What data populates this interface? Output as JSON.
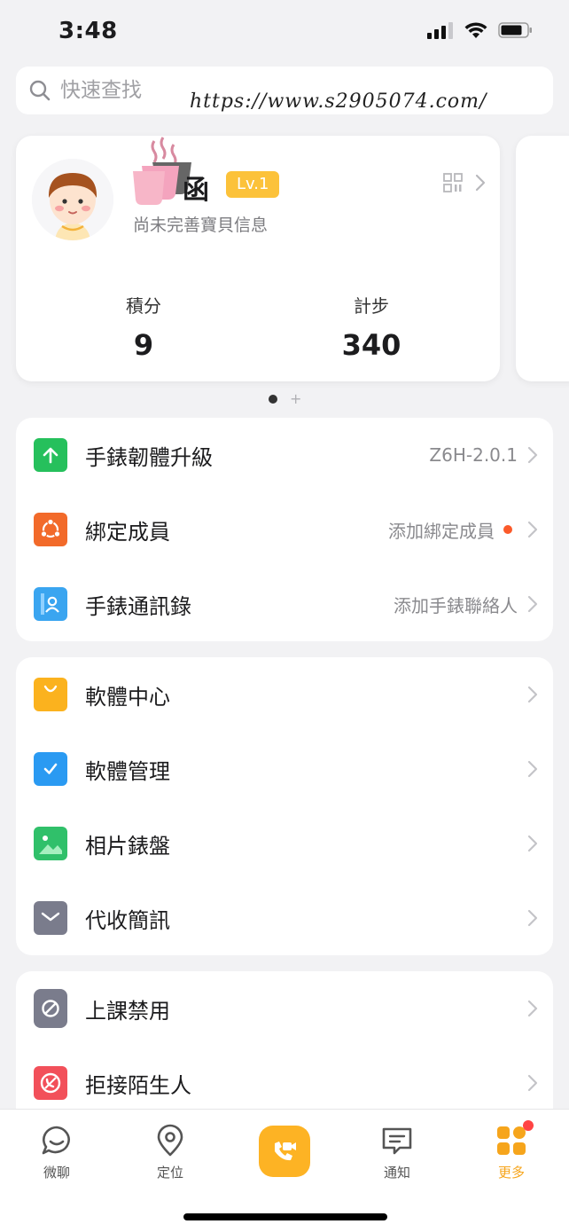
{
  "status_bar": {
    "time": "3:48"
  },
  "search": {
    "placeholder": "快速查找"
  },
  "watermark": {
    "text": "https://www.s2905074.com/"
  },
  "profile": {
    "name": "函",
    "level": "Lv.1",
    "subtitle": "尚未完善寶貝信息",
    "stats": [
      {
        "label": "積分",
        "value": "9"
      },
      {
        "label": "計步",
        "value": "340"
      }
    ]
  },
  "device_menu": [
    {
      "label": "手錶韌體升級",
      "value": "Z6H-2.0.1",
      "icon": "upgrade-icon",
      "color": "#26c05c"
    },
    {
      "label": "綁定成員",
      "value": "添加綁定成員",
      "icon": "share-members-icon",
      "color": "#f26a2a",
      "badge": true
    },
    {
      "label": "手錶通訊錄",
      "value": "添加手錶聯絡人",
      "icon": "contacts-icon",
      "color": "#3aa5f0"
    }
  ],
  "apps_menu": [
    {
      "label": "軟體中心",
      "icon": "shopping-bag-icon",
      "color": "#fbb21e"
    },
    {
      "label": "軟體管理",
      "icon": "checkmark-icon",
      "color": "#2a9af2"
    },
    {
      "label": "相片錶盤",
      "icon": "image-icon",
      "color": "#30c06a"
    },
    {
      "label": "代收簡訊",
      "icon": "envelope-icon",
      "color": "#7a7c8c"
    }
  ],
  "control_menu": [
    {
      "label": "上課禁用",
      "icon": "watch-disabled-icon",
      "color": "#7a7c8c"
    },
    {
      "label": "拒接陌生人",
      "icon": "block-call-icon",
      "color": "#f2505a"
    }
  ],
  "tab_bar": {
    "tabs": [
      {
        "label": "微聊",
        "icon": "chat-icon"
      },
      {
        "label": "定位",
        "icon": "location-pin-icon"
      },
      {
        "label": "",
        "icon": "video-call-icon"
      },
      {
        "label": "通知",
        "icon": "notification-icon"
      },
      {
        "label": "更多",
        "icon": "more-grid-icon",
        "active": true
      }
    ]
  }
}
